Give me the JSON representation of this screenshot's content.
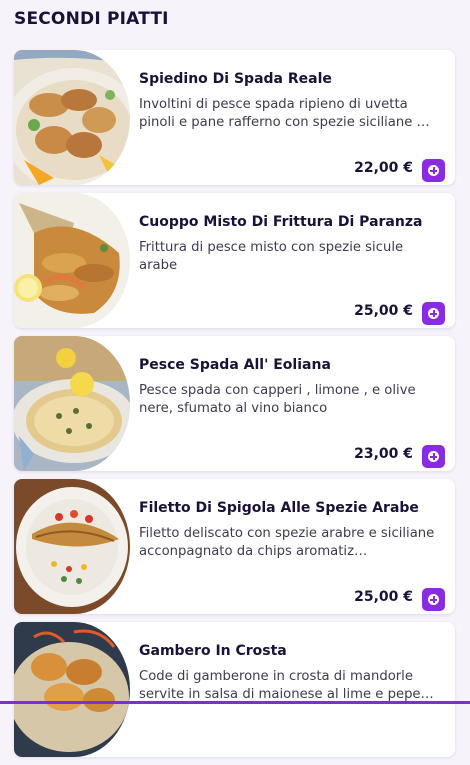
{
  "section": {
    "title": "SECONDI PIATTI"
  },
  "items": [
    {
      "name": "Spiedino Di Spada Reale",
      "description": "Involtini di pesce spada ripieno di uvetta pinoli e pane rafferno con spezie siciliane …",
      "price": "22,00 €",
      "image_icon": "swordfish-skewer-image"
    },
    {
      "name": "Cuoppo Misto Di Frittura Di Paranza",
      "description": "Frittura di pesce misto con spezie sicule arabe",
      "price": "25,00 €",
      "image_icon": "fried-fish-cone-image"
    },
    {
      "name": "Pesce Spada All' Eoliana",
      "description": "Pesce spada con capperi , limone , e olive nere, sfumato al vino bianco",
      "price": "23,00 €",
      "image_icon": "swordfish-plate-image"
    },
    {
      "name": "Filetto Di Spigola Alle Spezie Arabe",
      "description": "Filetto deliscato con spezie arabre e siciliane acconpagnato da chips aromatiz…",
      "price": "25,00 €",
      "image_icon": "sea-bass-fillet-image"
    },
    {
      "name": "Gambero In Crosta",
      "description": "Code di gamberone in crosta di mandorle servite in salsa di maionese al lime e pepe…",
      "price": "",
      "image_icon": "prawn-crust-image"
    }
  ],
  "colors": {
    "accent": "#8a2be2",
    "background": "#f7f3fb",
    "text": "#1a1236"
  }
}
